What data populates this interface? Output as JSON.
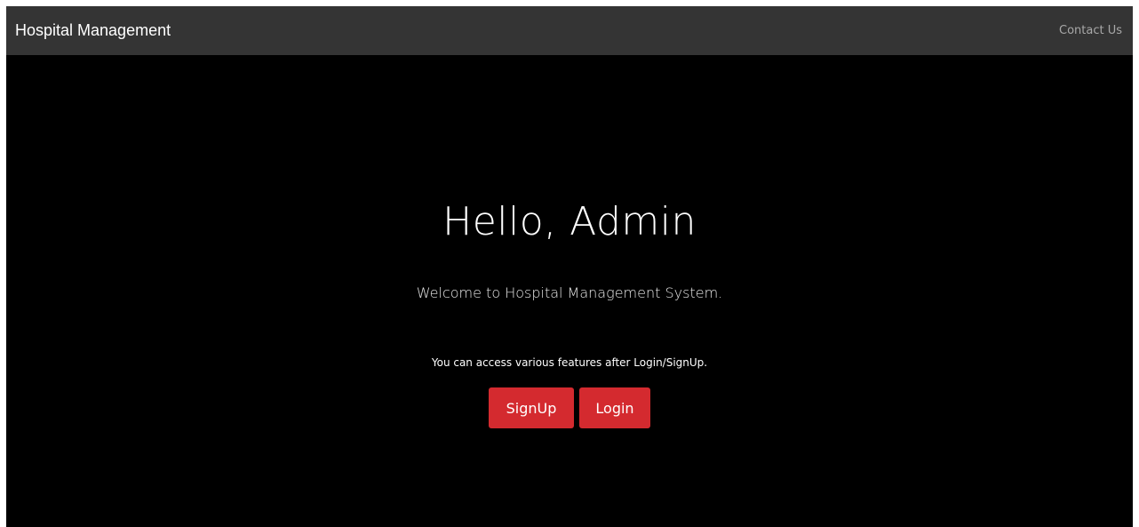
{
  "navbar": {
    "brand": "Hospital Management",
    "contact_link": "Contact Us"
  },
  "hero": {
    "title": "Hello, Admin",
    "lead": "Welcome to Hospital Management System.",
    "note": "You can access various features after Login/SignUp.",
    "signup_label": "SignUp",
    "login_label": "Login"
  },
  "colors": {
    "navbar_bg": "#343434",
    "page_bg": "#000000",
    "button_bg": "#d42a2f"
  }
}
